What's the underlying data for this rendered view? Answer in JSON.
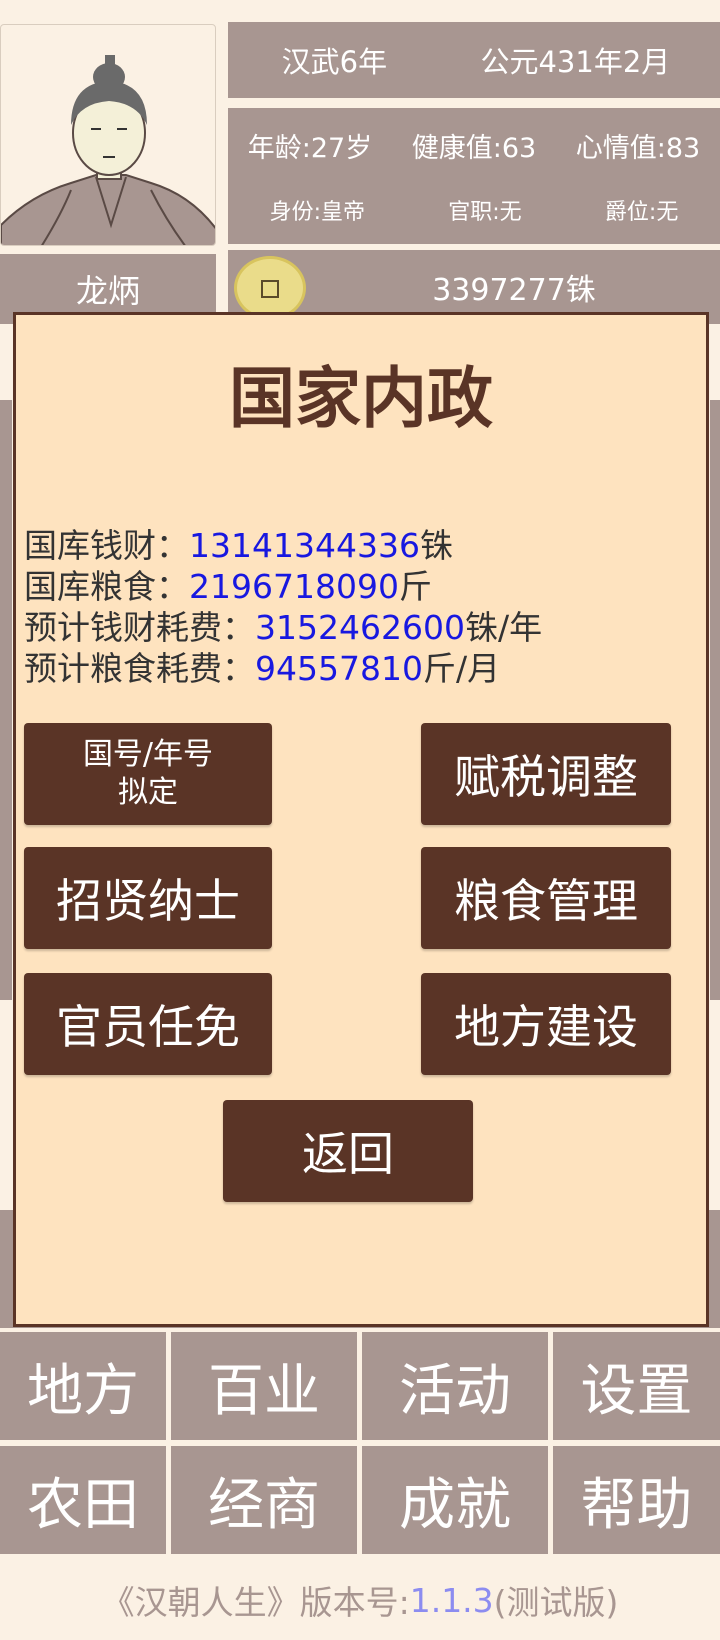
{
  "player": {
    "name": "龙炳"
  },
  "date": {
    "reign": "汉武6年",
    "ad": "公元431年2月"
  },
  "stats": {
    "age": "年龄:27岁",
    "health": "健康值:63",
    "mood": "心情值:83",
    "status": "身份:皇帝",
    "office": "官职:无",
    "rank": "爵位:无"
  },
  "money": "3397277铢",
  "modal": {
    "title": "国家内政",
    "info": [
      {
        "label": "国库钱财：",
        "value": "13141344336",
        "unit": "铢"
      },
      {
        "label": "国库粮食：",
        "value": "2196718090",
        "unit": "斤"
      },
      {
        "label": "预计钱财耗费：",
        "value": "3152462600",
        "unit": "铢/年"
      },
      {
        "label": "预计粮食耗费：",
        "value": "94557810",
        "unit": "斤/月"
      }
    ],
    "buttons": {
      "name_line1": "国号/年号",
      "name_line2": "拟定",
      "tax": "赋税调整",
      "recruit": "招贤纳士",
      "grain": "粮食管理",
      "officials": "官员任免",
      "build": "地方建设",
      "back": "返回"
    }
  },
  "nav": {
    "row1": [
      "地方",
      "百业",
      "活动",
      "设置"
    ],
    "row2": [
      "农田",
      "经商",
      "成就",
      "帮助"
    ]
  },
  "version": {
    "prefix": "《汉朝人生》版本号:",
    "number": "1.1.3",
    "suffix": "(测试版)"
  },
  "colors": {
    "panel": "#a89691",
    "modal_bg": "#fee3bf",
    "button": "#5a3426",
    "value_blue": "#1818e0"
  }
}
